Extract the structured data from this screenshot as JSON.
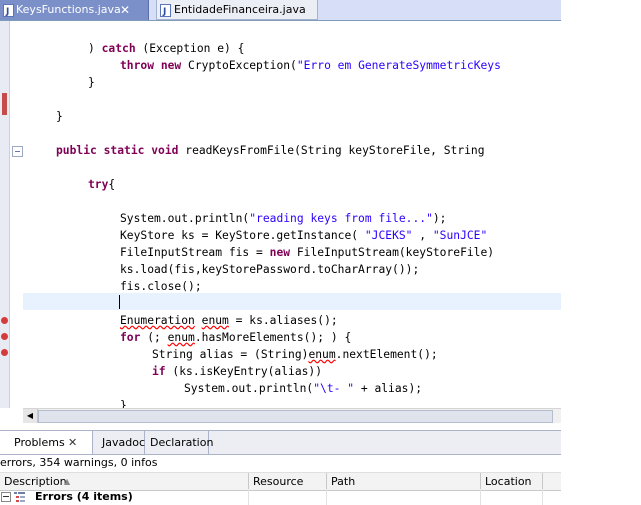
{
  "editor_tabs": [
    {
      "label": "KeysFunctions.java",
      "active": true,
      "icon": "java-file-icon",
      "close": "✕"
    },
    {
      "label": "EntidadeFinanceira.java",
      "active": false,
      "icon": "java-file-icon"
    }
  ],
  "colors": {
    "keyword": "#7f0055",
    "string": "#2a00ff",
    "active_tab": "#7b8fc8",
    "current_line": "#e8f2fe",
    "error_underline": "#ff0000"
  },
  "code": {
    "l01": ") catch (Exception e) {",
    "l02": "throw new CryptoException(\"Erro em GenerateSymmetricKeys",
    "l03": "}",
    "l04": "}",
    "l05": "public static void readKeysFromFile(String keyStoreFile, String",
    "l06": "try{",
    "l07": "System.out.println(\"reading keys from file...\");",
    "l08": "KeyStore ks = KeyStore.getInstance( \"JCEKS\" , \"SunJCE\"",
    "l09": "FileInputStream fis = new FileInputStream(keyStoreFile)",
    "l10": "ks.load(fis,keyStorePassword.toCharArray());",
    "l11": "fis.close();",
    "l12": "",
    "l13": "Enumeration enum = ks.aliases();",
    "l14": "for (; enum.hasMoreElements(); ) {",
    "l15": "String alias = (String)enum.nextElement();",
    "l16": "if (ks.isKeyEntry(alias))",
    "l17": "System.out.println(\"\\t- \" + alias);",
    "l18": "}"
  },
  "panel": {
    "tabs": {
      "problems": "Problems",
      "problems_close": "✕",
      "javadoc": "Javadoc",
      "declaration": "Declaration"
    },
    "summary": "errors, 354 warnings, 0 infos",
    "columns": {
      "description": "Description",
      "resource": "Resource",
      "path": "Path",
      "location": "Location"
    },
    "errors_group": "Errors (4 items)"
  }
}
